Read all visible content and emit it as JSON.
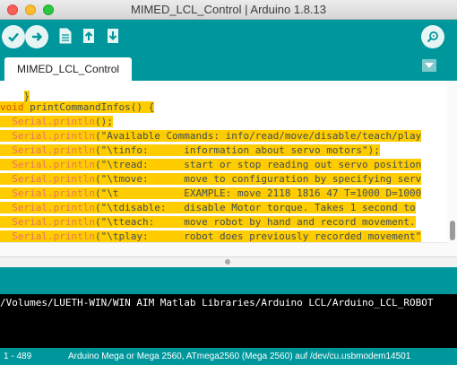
{
  "window": {
    "title": "MIMED_LCL_Control | Arduino 1.8.13"
  },
  "toolbar": {
    "verify": "check-icon",
    "upload": "arrow-right-icon",
    "new": "new-file-icon",
    "open": "open-arrow-up-icon",
    "save": "save-arrow-down-icon",
    "serial_monitor": "magnifier-icon"
  },
  "tabs": [
    {
      "label": "MIMED_LCL_Control"
    }
  ],
  "editor": {
    "line_fragment": "}",
    "lines": [
      {
        "kw": "void",
        "rest": " printCommandInfos() {"
      },
      {
        "obj": "  Serial.",
        "fn": "println",
        "rest": "();"
      },
      {
        "obj": "  Serial.",
        "fn": "println",
        "rest": "(\"Available Commands: info/read/move/disable/teach/play"
      },
      {
        "obj": "  Serial.",
        "fn": "println",
        "rest": "(\"\\tinfo:      information about servo motors\");"
      },
      {
        "obj": "  Serial.",
        "fn": "println",
        "rest": "(\"\\tread:      start or stop reading out servo position"
      },
      {
        "obj": "  Serial.",
        "fn": "println",
        "rest": "(\"\\tmove:      move to configuration by specifying serv"
      },
      {
        "obj": "  Serial.",
        "fn": "println",
        "rest": "(\"\\t           EXAMPLE: move 2118 1816 47 T=1000 D=1000"
      },
      {
        "obj": "  Serial.",
        "fn": "println",
        "rest": "(\"\\tdisable:   disable Motor torque. Takes 1 second to"
      },
      {
        "obj": "  Serial.",
        "fn": "println",
        "rest": "(\"\\tteach:     move robot by hand and record movement."
      },
      {
        "obj": "  Serial.",
        "fn": "println",
        "rest": "(\"\\tplay:      robot does previously recorded movement\""
      }
    ]
  },
  "console": {
    "text": "/Volumes/LUETH-WIN/WIN AIM Matlab Libraries/Arduino LCL/Arduino_LCL_ROBOT"
  },
  "footer": {
    "line_range": "1 - 489",
    "board": "Arduino Mega or Mega 2560, ATmega2560 (Mega 2560) auf /dev/cu.usbmodem14501"
  },
  "colors": {
    "teal": "#00979c",
    "highlight": "#ffcc00",
    "keyword": "#d35400",
    "function": "#e97366"
  }
}
